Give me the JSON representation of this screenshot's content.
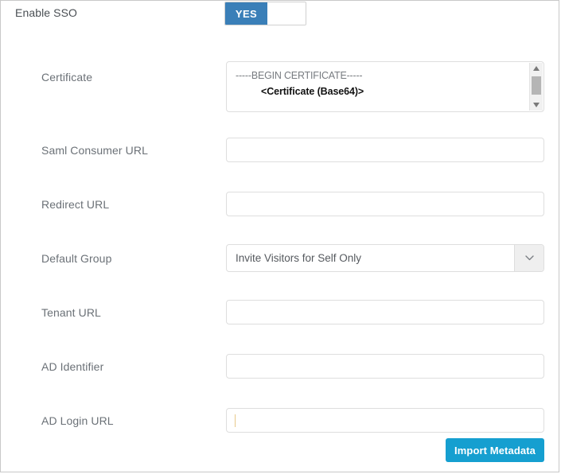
{
  "form": {
    "sso": {
      "label": "Enable SSO",
      "toggle_on_label": "YES",
      "toggle_value": "YES"
    },
    "fields": [
      {
        "label": "Certificate",
        "type": "textarea",
        "line1": "-----BEGIN CERTIFICATE-----",
        "line2": "<Certificate (Base64)>",
        "value": ""
      },
      {
        "label": "Saml Consumer URL",
        "type": "text",
        "value": "",
        "placeholder": ""
      },
      {
        "label": "Redirect URL",
        "type": "text",
        "value": "",
        "placeholder": ""
      },
      {
        "label": "Default Group",
        "type": "select",
        "value": "Invite Visitors for Self Only",
        "icon": "chevron-down-icon"
      },
      {
        "label": "Tenant URL",
        "type": "text",
        "value": "",
        "placeholder": ""
      },
      {
        "label": "AD Identifier",
        "type": "text",
        "value": "",
        "placeholder": ""
      },
      {
        "label": "AD Login URL",
        "type": "text",
        "value": "",
        "placeholder": "",
        "focused": true
      }
    ],
    "actions": {
      "import_metadata": "Import Metadata"
    }
  },
  "scrollbar": {
    "up_icon": "triangle-up-icon",
    "down_icon": "triangle-down-icon"
  },
  "colors": {
    "toggle_on": "#3a7fb8",
    "primary_button": "#159fd0",
    "label_text": "#6b7177",
    "border": "#dedede",
    "panel_border": "#c8c8c8"
  }
}
